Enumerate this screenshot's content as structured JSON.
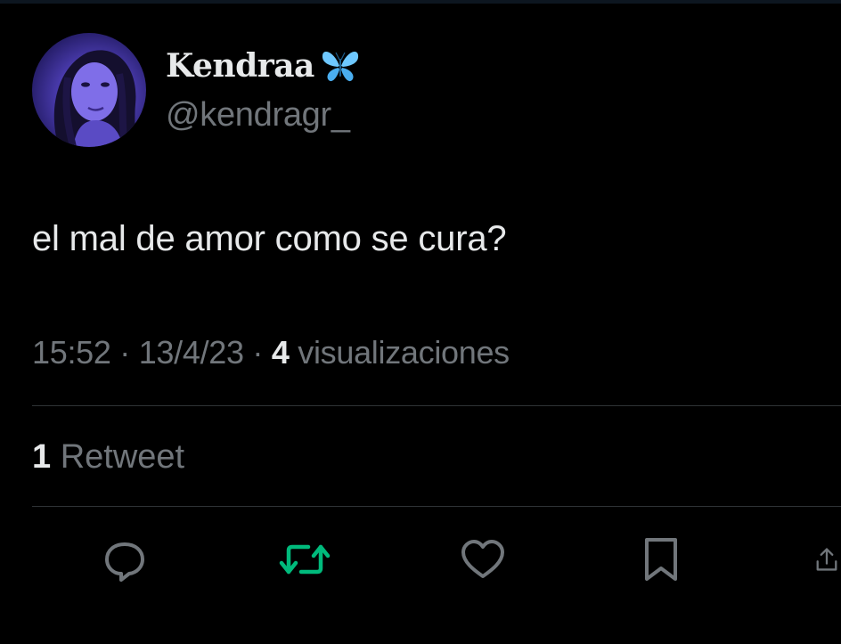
{
  "user": {
    "display_name": "Kendraa",
    "name_emoji_icon": "butterfly-icon",
    "handle": "@kendragr_",
    "avatar": "avatar-photo"
  },
  "tweet": {
    "text": "el mal de amor como se cura?",
    "time": "15:52",
    "separator": "·",
    "date": "13/4/23",
    "views_count": "4",
    "views_label": "visualizaciones"
  },
  "stats": {
    "retweets_count": "1",
    "retweets_label": "Retweet"
  },
  "actions": [
    {
      "name": "reply-button",
      "icon": "reply-icon"
    },
    {
      "name": "retweet-button",
      "icon": "retweet-icon",
      "active_color": "#00ba7c"
    },
    {
      "name": "like-button",
      "icon": "heart-icon"
    },
    {
      "name": "bookmark-button",
      "icon": "bookmark-icon"
    },
    {
      "name": "share-button",
      "icon": "share-icon"
    }
  ],
  "colors": {
    "background": "#000000",
    "primary_text": "#e7e9ea",
    "secondary_text": "#71767b",
    "divider": "#2f3336",
    "retweet_green": "#00ba7c",
    "butterfly_blue": "#6ec8ff"
  }
}
